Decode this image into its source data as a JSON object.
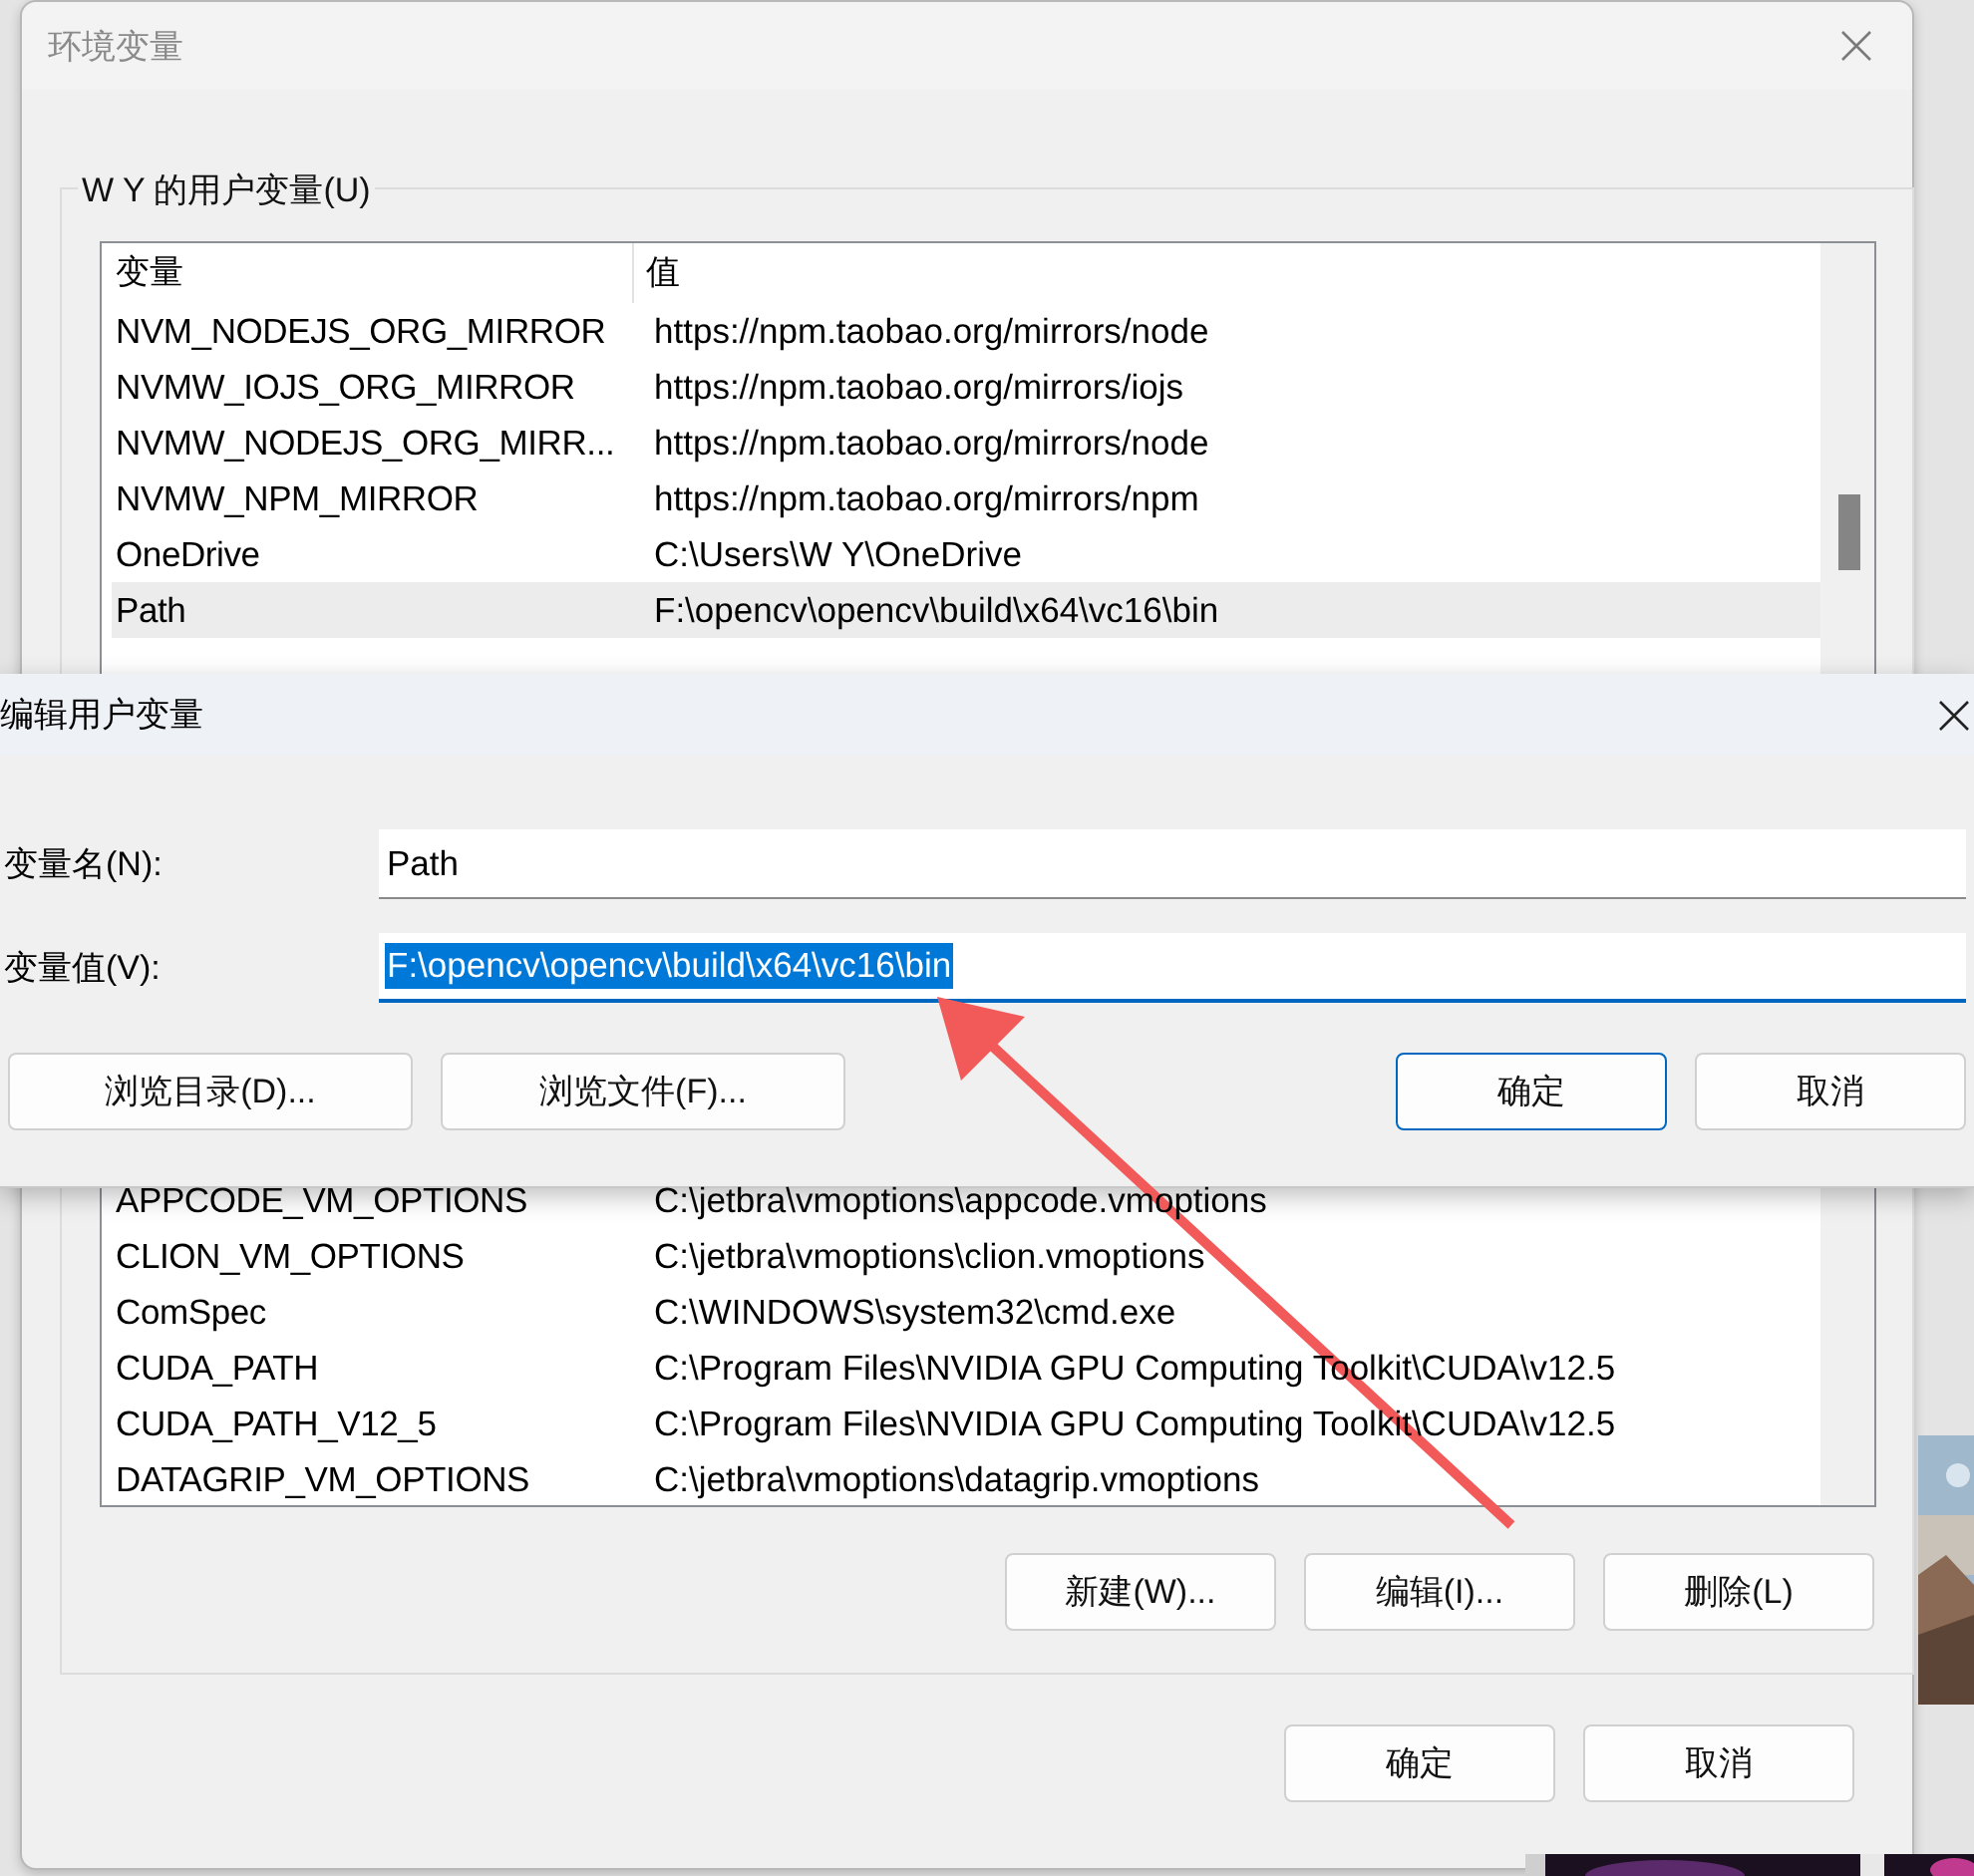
{
  "main_window": {
    "title": "环境变量",
    "group_label": "W Y 的用户变量(U)",
    "table": {
      "columns": [
        "变量",
        "值"
      ],
      "rows": [
        {
          "name": "NVM_NODEJS_ORG_MIRROR",
          "value": "https://npm.taobao.org/mirrors/node",
          "selected": false
        },
        {
          "name": "NVMW_IOJS_ORG_MIRROR",
          "value": "https://npm.taobao.org/mirrors/iojs",
          "selected": false
        },
        {
          "name": "NVMW_NODEJS_ORG_MIRR...",
          "value": "https://npm.taobao.org/mirrors/node",
          "selected": false
        },
        {
          "name": "NVMW_NPM_MIRROR",
          "value": "https://npm.taobao.org/mirrors/npm",
          "selected": false
        },
        {
          "name": "OneDrive",
          "value": "C:\\Users\\W Y\\OneDrive",
          "selected": false
        },
        {
          "name": "Path",
          "value": "F:\\opencv\\opencv\\build\\x64\\vc16\\bin",
          "selected": true
        }
      ],
      "rows_below_dialog": [
        {
          "name": "APPCODE_VM_OPTIONS",
          "value": "C:\\jetbra\\vmoptions\\appcode.vmoptions",
          "selected": false
        },
        {
          "name": "CLION_VM_OPTIONS",
          "value": "C:\\jetbra\\vmoptions\\clion.vmoptions",
          "selected": false
        },
        {
          "name": "ComSpec",
          "value": "C:\\WINDOWS\\system32\\cmd.exe",
          "selected": false
        },
        {
          "name": "CUDA_PATH",
          "value": "C:\\Program Files\\NVIDIA GPU Computing Toolkit\\CUDA\\v12.5",
          "selected": false
        },
        {
          "name": "CUDA_PATH_V12_5",
          "value": "C:\\Program Files\\NVIDIA GPU Computing Toolkit\\CUDA\\v12.5",
          "selected": false
        },
        {
          "name": "DATAGRIP_VM_OPTIONS",
          "value": "C:\\jetbra\\vmoptions\\datagrip.vmoptions",
          "selected": false
        }
      ]
    },
    "list_buttons": [
      "新建(W)...",
      "编辑(I)...",
      "删除(L)"
    ],
    "buttons": [
      {
        "label": "确定",
        "default": false
      },
      {
        "label": "取消",
        "default": false
      }
    ]
  },
  "edit_dialog": {
    "title": "编辑用户变量",
    "fields": [
      {
        "label": "变量名(N):",
        "value": "Path",
        "focused": false
      },
      {
        "label": "变量值(V):",
        "value": "F:\\opencv\\opencv\\build\\x64\\vc16\\bin",
        "focused": true
      }
    ],
    "browse_buttons": [
      "浏览目录(D)...",
      "浏览文件(F)..."
    ],
    "buttons": [
      {
        "label": "确定",
        "default": true
      },
      {
        "label": "取消",
        "default": false
      }
    ]
  }
}
